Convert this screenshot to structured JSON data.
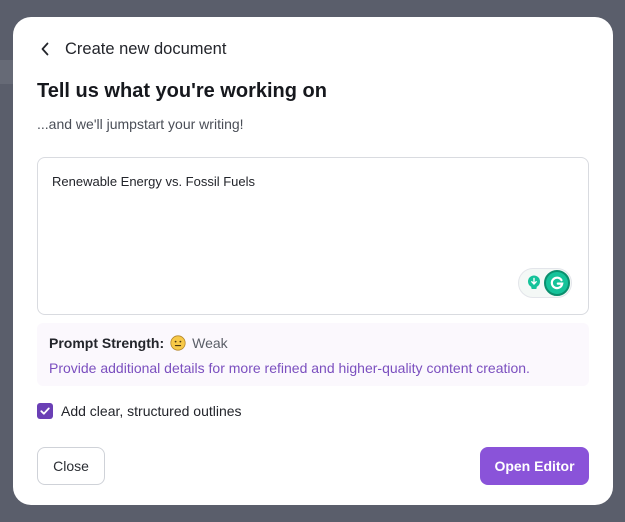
{
  "header": {
    "back_icon": "chevron-left-icon",
    "title": "Create new document"
  },
  "main": {
    "title": "Tell us what you're working on",
    "subtitle": "...and we'll jumpstart your writing!"
  },
  "prompt": {
    "value": "Renewable Energy vs. Fossil Fuels",
    "assist_icons": [
      "lightbulb-icon",
      "grammarly-icon"
    ]
  },
  "strength": {
    "label": "Prompt Strength:",
    "emoji": "neutral-face-icon",
    "value": "Weak",
    "hint": "Provide additional details for more refined and higher-quality content creation."
  },
  "outline_option": {
    "label": "Add clear, structured outlines",
    "checked": true
  },
  "footer": {
    "close_label": "Close",
    "open_label": "Open Editor"
  },
  "colors": {
    "accent": "#8a53d9",
    "checkbox": "#6a3fb5",
    "hint_text": "#7b4fbf",
    "grammarly": "#15c39a"
  }
}
